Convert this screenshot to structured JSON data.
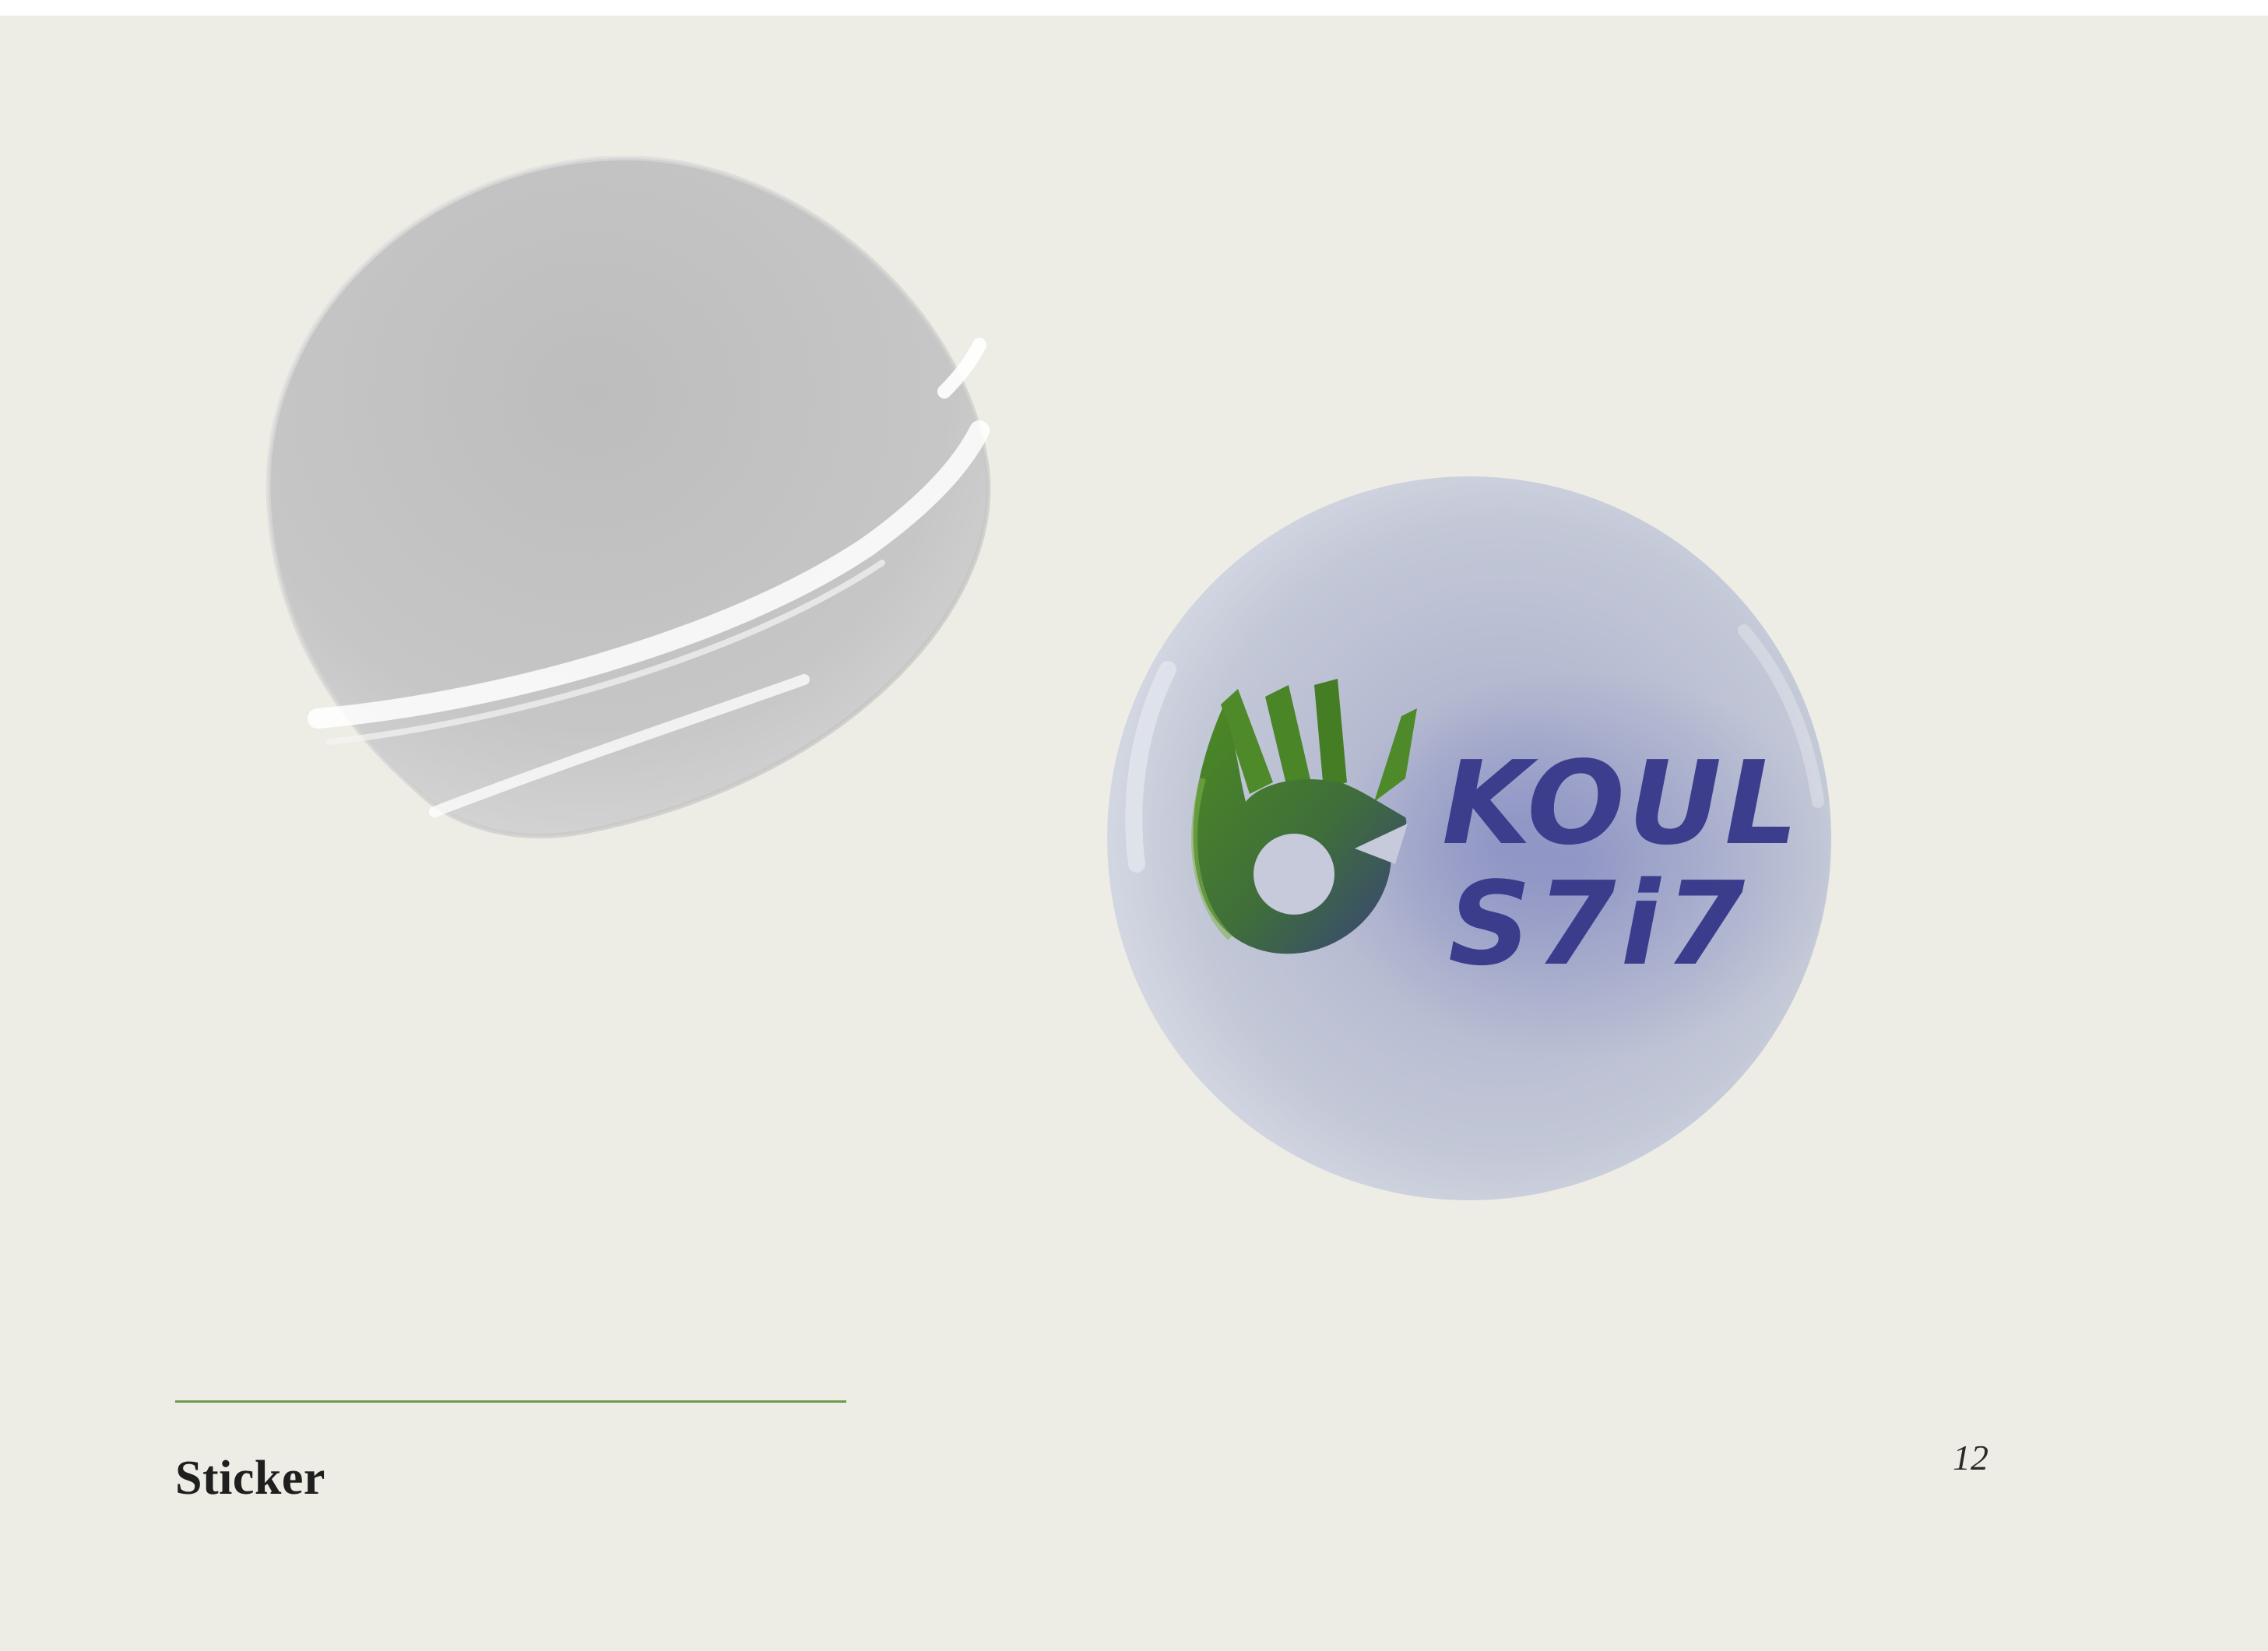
{
  "caption": "Sticker",
  "page_number": "12",
  "logo": {
    "line1": "KOUL",
    "line2": "S7i7",
    "icon": "ok-hand-icon"
  },
  "colors": {
    "background": "#eeede5",
    "divider": "#6e9a4f",
    "logo_text": "#3d3d8e",
    "logo_hand": "#4f8a2a",
    "sticker_silver": "#c2c2c2",
    "sticker_face": "#bec3d3"
  }
}
